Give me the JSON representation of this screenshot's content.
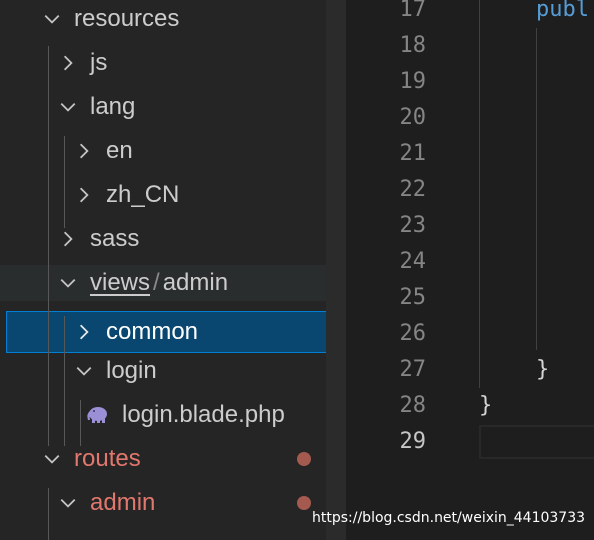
{
  "explorer": {
    "items": [
      {
        "label": "resources",
        "expanded": true
      },
      {
        "label": "js",
        "expanded": false
      },
      {
        "label": "lang",
        "expanded": true
      },
      {
        "label": "en",
        "expanded": false
      },
      {
        "label": "zh_CN",
        "expanded": false
      },
      {
        "label": "sass",
        "expanded": false
      },
      {
        "label": "views",
        "compact_suffix": "admin",
        "separator": "/",
        "expanded": true
      },
      {
        "label": "common",
        "expanded": false,
        "selected": true
      },
      {
        "label": "login",
        "expanded": true
      },
      {
        "label": "login.blade.php",
        "icon": "php-elephant-icon"
      },
      {
        "label": "routes",
        "expanded": true,
        "git_status": "modified"
      },
      {
        "label": "admin",
        "expanded": true,
        "git_status": "modified"
      }
    ]
  },
  "editor": {
    "line_numbers": [
      "17",
      "18",
      "19",
      "20",
      "21",
      "22",
      "23",
      "24",
      "25",
      "26",
      "27",
      "28",
      "29"
    ],
    "active_line": "29",
    "code": {
      "line17": "publ",
      "line27": "}",
      "line28": "}"
    }
  },
  "watermark": "https://blog.csdn.net/weixin_44103733",
  "colors": {
    "sidebar_bg": "#252526",
    "editor_bg": "#1e1e1e",
    "selection_bg": "#094771",
    "selection_border": "#007fd4",
    "modified_text": "#e2786d",
    "keyword": "#569cd6"
  }
}
